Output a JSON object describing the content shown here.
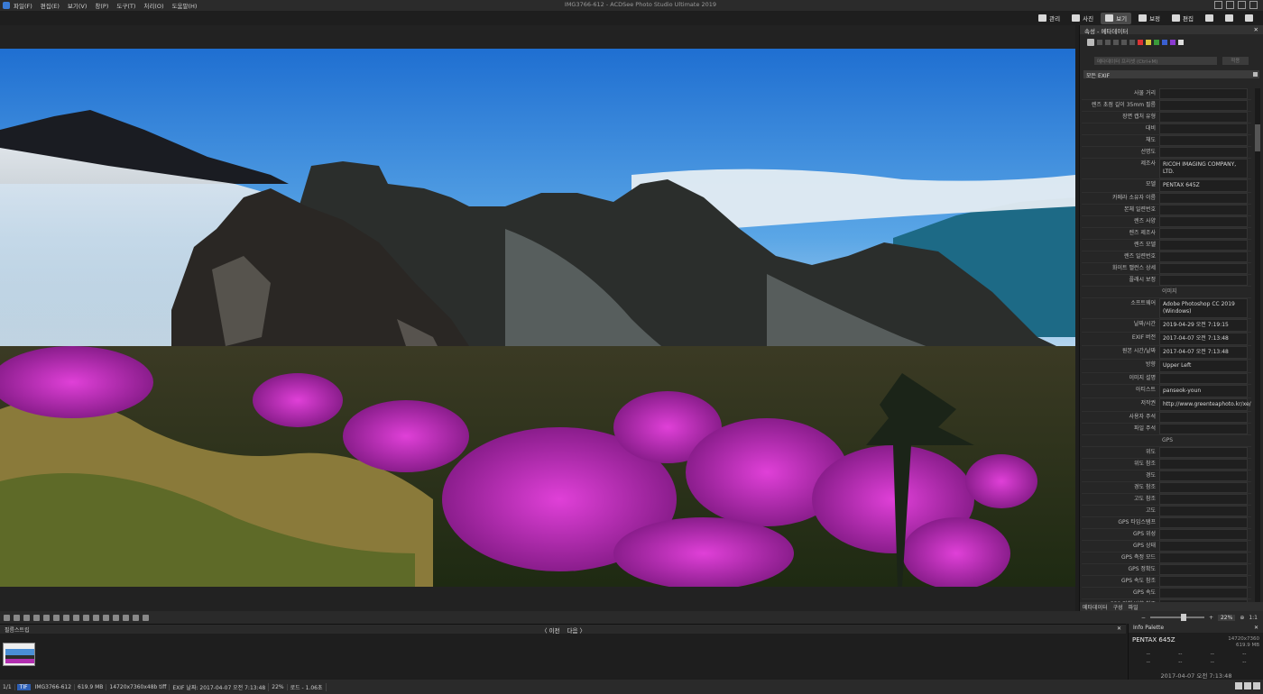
{
  "window": {
    "title": "IMG3766-612 - ACDSee Photo Studio Ultimate 2019",
    "menu": [
      "파일(F)",
      "편집(E)",
      "보기(V)",
      "창(P)",
      "도구(T)",
      "처리(O)",
      "도움말(H)"
    ]
  },
  "modes": [
    {
      "label": "관리",
      "active": false
    },
    {
      "label": "사진",
      "active": false
    },
    {
      "label": "보기",
      "active": true
    },
    {
      "label": "보정",
      "active": false
    },
    {
      "label": "편집",
      "active": false
    }
  ],
  "panel": {
    "title": "속성 - 메타데이터",
    "preset_placeholder": "메타데이터 프리셋 (Ctrl+M)",
    "apply_label": "적용",
    "exif_select": "모든 EXIF",
    "footer_tabs": [
      "메타데이터",
      "구성",
      "파일"
    ],
    "metadata": [
      {
        "key": "사물 거리",
        "value": ""
      },
      {
        "key": "렌즈 초점 길이 35mm 필름",
        "value": ""
      },
      {
        "key": "장면 캡처 유형",
        "value": ""
      },
      {
        "key": "대비",
        "value": ""
      },
      {
        "key": "채도",
        "value": ""
      },
      {
        "key": "선명도",
        "value": ""
      },
      {
        "key": "제조사",
        "value": "RICOH IMAGING COMPANY, LTD."
      },
      {
        "key": "모델",
        "value": "PENTAX 645Z"
      },
      {
        "key": "카메라 소유자 이름",
        "value": ""
      },
      {
        "key": "본체 일련번호",
        "value": ""
      },
      {
        "key": "렌즈 사양",
        "value": ""
      },
      {
        "key": "렌즈 제조사",
        "value": ""
      },
      {
        "key": "렌즈 모델",
        "value": ""
      },
      {
        "key": "렌즈 일련번호",
        "value": ""
      },
      {
        "key": "화이트 밸런스 상세",
        "value": ""
      },
      {
        "key": "플래시 보정",
        "value": ""
      },
      {
        "key": "",
        "value": "이미지",
        "section": true
      },
      {
        "key": "소프트웨어",
        "value": "Adobe Photoshop CC 2019 (Windows)"
      },
      {
        "key": "날짜/시간",
        "value": "2019-04-29 오전 7:19:15"
      },
      {
        "key": "EXIF 버전",
        "value": "2017-04-07 오전 7:13:48"
      },
      {
        "key": "원본 시간/날짜",
        "value": "2017-04-07 오전 7:13:48"
      },
      {
        "key": "방향",
        "value": "Upper Left"
      },
      {
        "key": "이미지 설명",
        "value": ""
      },
      {
        "key": "아티스트",
        "value": "panseok-youn"
      },
      {
        "key": "저작권",
        "value": "http://www.greenteaphoto.kr/xe/"
      },
      {
        "key": "사용자 주석",
        "value": ""
      },
      {
        "key": "파일 주석",
        "value": ""
      },
      {
        "key": "",
        "value": "GPS",
        "section": true
      },
      {
        "key": "위도",
        "value": ""
      },
      {
        "key": "위도 참조",
        "value": ""
      },
      {
        "key": "경도",
        "value": ""
      },
      {
        "key": "경도 참조",
        "value": ""
      },
      {
        "key": "고도 참조",
        "value": ""
      },
      {
        "key": "고도",
        "value": ""
      },
      {
        "key": "GPS 타임스탬프",
        "value": ""
      },
      {
        "key": "GPS 위성",
        "value": ""
      },
      {
        "key": "GPS 상태",
        "value": ""
      },
      {
        "key": "GPS 측정 모드",
        "value": ""
      },
      {
        "key": "GPS 정확도",
        "value": ""
      },
      {
        "key": "GPS 속도 참조",
        "value": ""
      },
      {
        "key": "GPS 속도",
        "value": ""
      },
      {
        "key": "GPS 진행 방향 참조",
        "value": ""
      }
    ]
  },
  "zoom": {
    "value": "22%",
    "ratio": "1:1"
  },
  "filmstrip": {
    "title": "필름스트립",
    "prev": "이전",
    "next": "다음"
  },
  "info_palette": {
    "title": "Info Palette",
    "model": "PENTAX 645Z",
    "dims": "14720x7360",
    "size": "619.9 MB",
    "cells": [
      "--",
      "--",
      "--",
      "--",
      "--",
      "--",
      "--",
      "--"
    ],
    "date": "2017-04-07 오전 7:13:48"
  },
  "status": {
    "page": "1/1",
    "format": "TIF",
    "filename": "IMG3766-612",
    "filesize": "619.9 MB",
    "dims": "14720x7360x48b tiff",
    "exif_date": "EXIF 날짜: 2017-04-07 오전 7:13:48",
    "zoom": "22%",
    "load": "로드 - 1.06초"
  },
  "colors": {
    "accent": "#2d5fb5",
    "panel_bg": "#262626",
    "app_bg": "#1e1e1e"
  }
}
